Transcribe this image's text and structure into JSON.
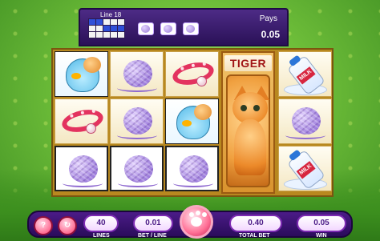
{
  "header": {
    "line_label": "Line 18",
    "pays_label": "Pays",
    "pays_value": "0.05",
    "line_pattern": [
      [
        true,
        true,
        false,
        false,
        false
      ],
      [
        false,
        false,
        true,
        true,
        true
      ],
      [
        false,
        false,
        false,
        false,
        false
      ]
    ]
  },
  "reels": {
    "tiger_title": "TIGER",
    "milk_text": "MILK"
  },
  "controls": {
    "lines_value": "40",
    "lines_label": "LINES",
    "bet_line_value": "0.01",
    "bet_line_label": "BET / LINE",
    "total_bet_value": "0.40",
    "total_bet_label": "TOTAL BET",
    "win_value": "0.05",
    "win_label": "WIN"
  }
}
